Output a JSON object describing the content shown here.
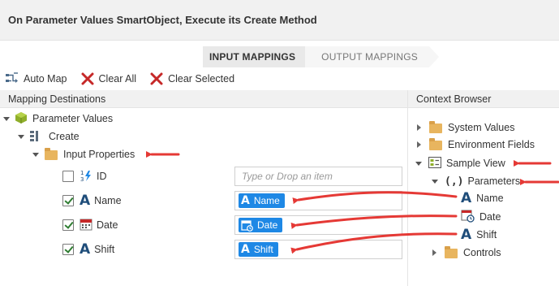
{
  "window": {
    "title": "On Parameter Values SmartObject, Execute its Create Method"
  },
  "tabs": [
    {
      "label": "INPUT MAPPINGS",
      "active": true
    },
    {
      "label": "OUTPUT MAPPINGS",
      "active": false
    }
  ],
  "toolbar": {
    "auto_map": "Auto Map",
    "clear_all": "Clear All",
    "clear_selected": "Clear Selected"
  },
  "destinations": {
    "header": "Mapping Destinations",
    "root": "Parameter Values",
    "method": "Create",
    "group": "Input Properties",
    "properties": [
      {
        "label": "ID",
        "checked": false,
        "icon": "autonumber-icon",
        "value": "",
        "placeholder": "Type or Drop an item"
      },
      {
        "label": "Name",
        "checked": true,
        "icon": "text-icon",
        "value": "Name",
        "placeholder": ""
      },
      {
        "label": "Date",
        "checked": true,
        "icon": "date-icon",
        "value": "Date",
        "placeholder": ""
      },
      {
        "label": "Shift",
        "checked": true,
        "icon": "text-icon",
        "value": "Shift",
        "placeholder": ""
      }
    ]
  },
  "context": {
    "header": "Context Browser",
    "items": [
      {
        "label": "System Values",
        "icon": "folder-icon",
        "expanded": false
      },
      {
        "label": "Environment Fields",
        "icon": "folder-icon",
        "expanded": false
      },
      {
        "label": "Sample View",
        "icon": "view-icon",
        "expanded": true
      },
      {
        "label": "Parameters",
        "icon": "parameters-icon",
        "expanded": true
      },
      {
        "label": "Name",
        "icon": "text-icon"
      },
      {
        "label": "Date",
        "icon": "date-icon"
      },
      {
        "label": "Shift",
        "icon": "text-icon"
      },
      {
        "label": "Controls",
        "icon": "folder-icon",
        "expanded": false
      }
    ]
  },
  "colors": {
    "annotation_arrow": "#e53935",
    "chip": "#1e88e5",
    "text_icon": "#1f4d7a"
  }
}
